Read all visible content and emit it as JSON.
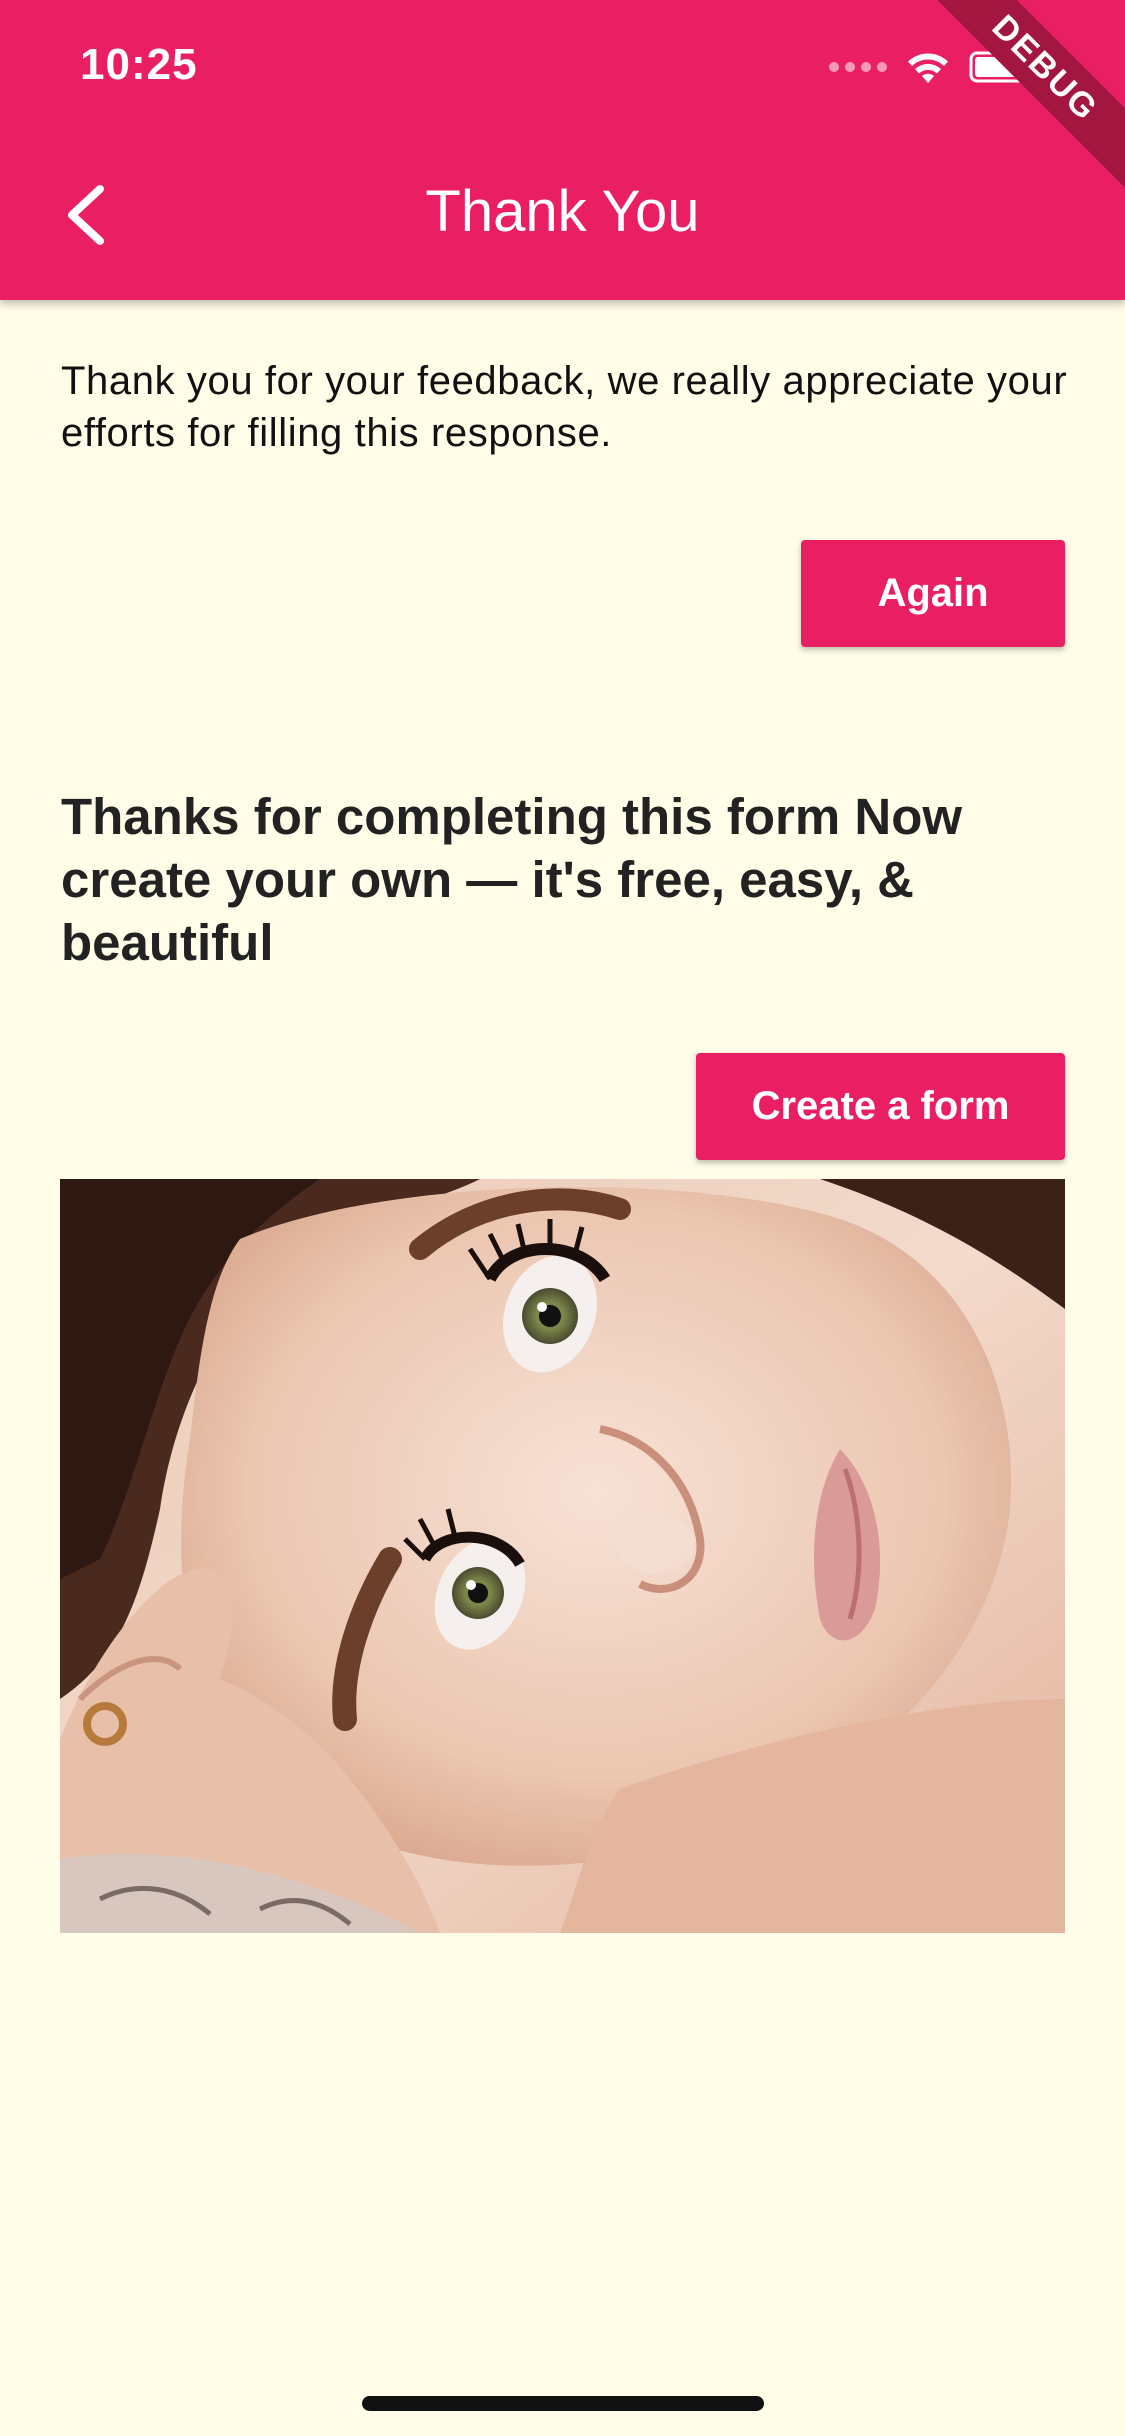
{
  "status_bar": {
    "time": "10:25"
  },
  "debug_banner": "DEBUG",
  "app_bar": {
    "title": "Thank You",
    "back_icon": "chevron-left-icon",
    "color": "#E91E63"
  },
  "content": {
    "thank_you_message": "Thank you for your feedback, we really appreciate your efforts for filling this response.",
    "again_button_label": "Again",
    "promo_heading": "Thanks for completing this form Now create your own — it's free, easy, & beautiful",
    "create_form_button_label": "Create a form",
    "image_subject": "portrait-photo"
  },
  "colors": {
    "accent": "#E91E63",
    "background": "#FFFDE7"
  }
}
